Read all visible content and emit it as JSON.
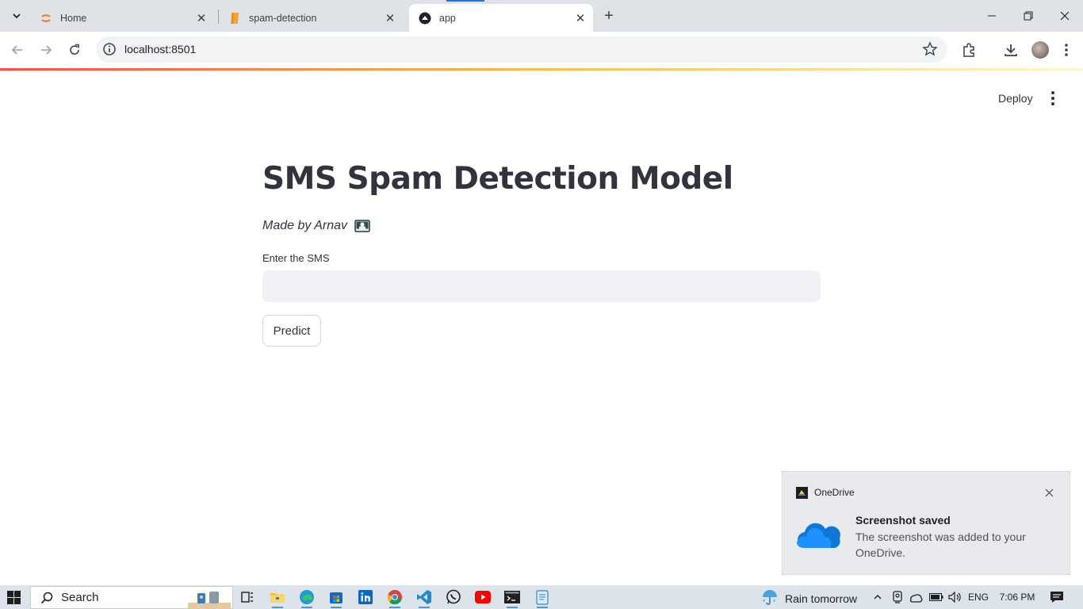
{
  "browser": {
    "tabs": [
      {
        "title": "Home",
        "favicon": "jupyter-icon",
        "active": false
      },
      {
        "title": "spam-detection",
        "favicon": "notebook-icon",
        "active": false
      },
      {
        "title": "app",
        "favicon": "streamlit-icon",
        "active": true
      }
    ],
    "close_glyph": "✕",
    "new_tab_glyph": "+",
    "url": "localhost:8501"
  },
  "header": {
    "deploy_label": "Deploy"
  },
  "main": {
    "title": "SMS Spam Detection Model",
    "byline": "Made by Arnav",
    "input_label": "Enter the SMS",
    "input_value": "",
    "predict_label": "Predict"
  },
  "toast": {
    "app_name": "OneDrive",
    "heading": "Screenshot saved",
    "body": "The screenshot was added to your OneDrive."
  },
  "taskbar": {
    "search_label": "Search",
    "weather": "Rain tomorrow",
    "language": "ENG",
    "time": "7:06 PM"
  },
  "colors": {
    "accent": "#ff4b4b",
    "input_bg": "#f0f2f6",
    "text": "#31333f"
  }
}
